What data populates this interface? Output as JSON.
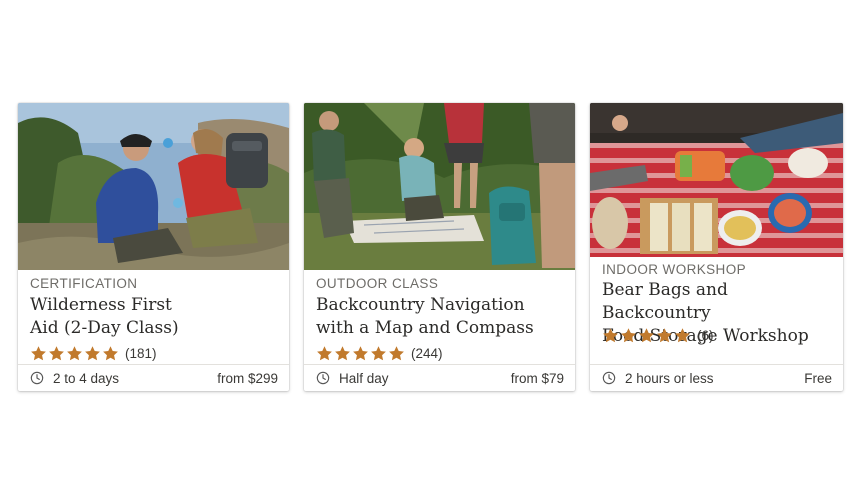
{
  "colors": {
    "star": "#c17a2d",
    "text": "#2b2a28",
    "muted": "#6e6c68",
    "divider": "#e3e1dd"
  },
  "cards": [
    {
      "category": "CERTIFICATION",
      "title_line1": "Wilderness First",
      "title_line2": "Aid (2-Day Class)",
      "stars": 5,
      "reviews": "(181)",
      "duration": "2 to 4 days",
      "price": "from $299",
      "icon": "clock-icon"
    },
    {
      "category": "OUTDOOR CLASS",
      "title_line1": "Backcountry Navigation",
      "title_line2": "with a Map and Compass",
      "stars": 5,
      "reviews": "(244)",
      "duration": "Half day",
      "price": "from $79",
      "icon": "clock-icon"
    },
    {
      "category": "INDOOR WORKSHOP",
      "title_line1": "Bear Bags and Backcountry",
      "title_line2": "Food Storage Workshop",
      "stars": 5,
      "reviews": "(6)",
      "duration": "2 hours or less",
      "price": "Free",
      "icon": "clock-icon"
    }
  ]
}
